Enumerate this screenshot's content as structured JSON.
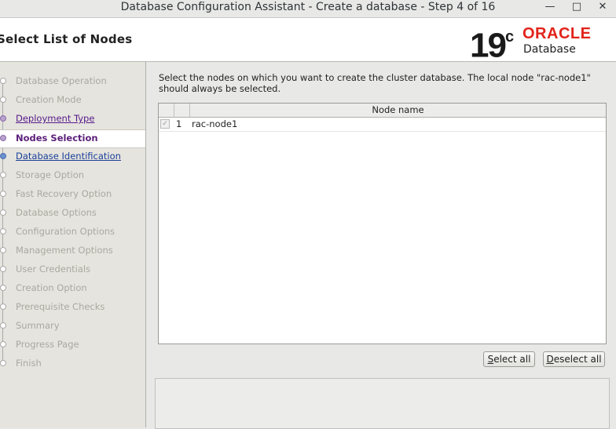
{
  "window": {
    "title": "Database Configuration Assistant - Create a database - Step 4 of 16",
    "controls": [
      "minimize-icon",
      "maximize-icon",
      "close-icon"
    ]
  },
  "header": {
    "heading": "Select List of Nodes",
    "logo_version": "19",
    "logo_sup": "c",
    "logo_brand": "ORACLE",
    "logo_product": "Database",
    "brand_color": "#e2231a"
  },
  "steps": [
    {
      "label": "Database Operation",
      "state": "disabled"
    },
    {
      "label": "Creation Mode",
      "state": "disabled"
    },
    {
      "label": "Deployment Type",
      "state": "done"
    },
    {
      "label": "Nodes Selection",
      "state": "current"
    },
    {
      "label": "Database Identification",
      "state": "next"
    },
    {
      "label": "Storage Option",
      "state": "disabled"
    },
    {
      "label": "Fast Recovery Option",
      "state": "disabled"
    },
    {
      "label": "Database Options",
      "state": "disabled"
    },
    {
      "label": "Configuration Options",
      "state": "disabled"
    },
    {
      "label": "Management Options",
      "state": "disabled"
    },
    {
      "label": "User Credentials",
      "state": "disabled"
    },
    {
      "label": "Creation Option",
      "state": "disabled"
    },
    {
      "label": "Prerequisite Checks",
      "state": "disabled"
    },
    {
      "label": "Summary",
      "state": "disabled"
    },
    {
      "label": "Progress Page",
      "state": "disabled"
    },
    {
      "label": "Finish",
      "state": "disabled"
    }
  ],
  "main": {
    "instruction": "Select the nodes on which you want to create the cluster database. The local node \"rac-node1\" should always be selected.",
    "table": {
      "header_name": "Node name",
      "rows": [
        {
          "num": "1",
          "name": "rac-node1",
          "checked": true
        }
      ]
    },
    "select_all": {
      "mnemonic": "S",
      "rest": "elect all"
    },
    "deselect_all": {
      "mnemonic": "D",
      "rest": "eselect all"
    }
  }
}
